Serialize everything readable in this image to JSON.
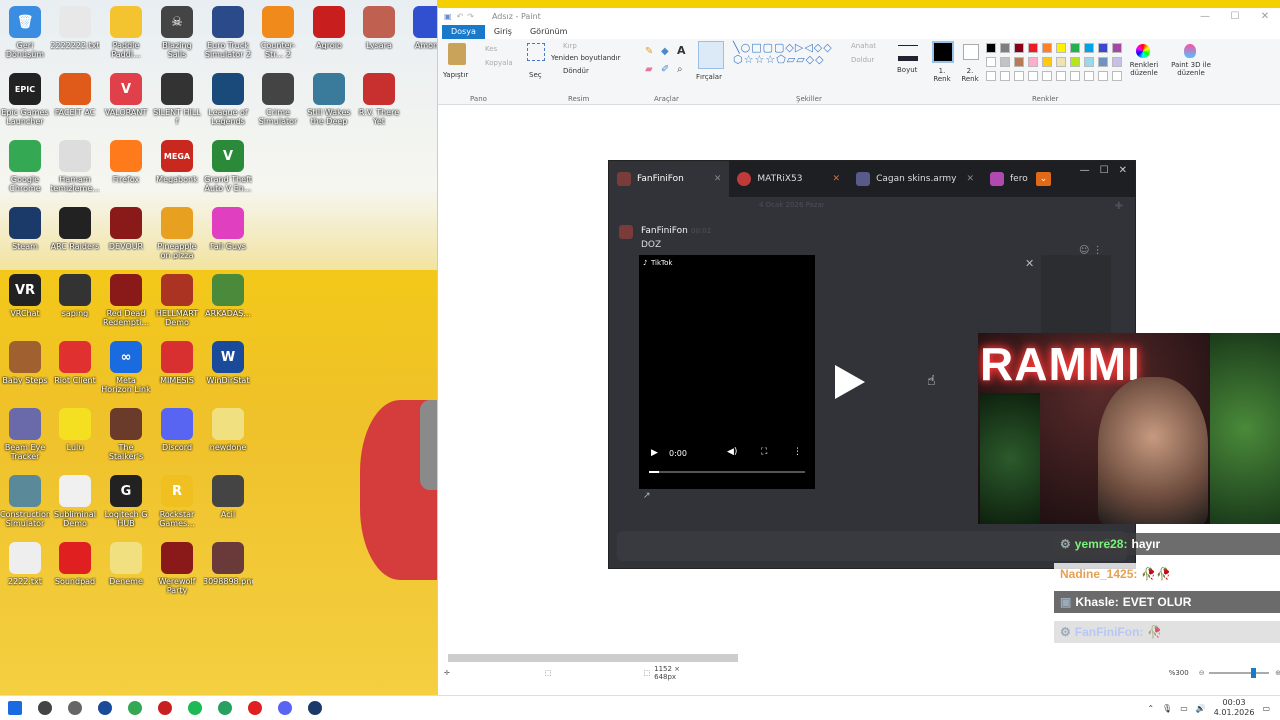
{
  "desktop": {
    "icons": [
      {
        "label": "Geri Dönüşüm",
        "color": "#3a8de0",
        "glyph": "🗑"
      },
      {
        "label": "2222222.txt",
        "color": "#e8e8e8",
        "glyph": ""
      },
      {
        "label": "Paddle Paddl...",
        "color": "#f4c430",
        "glyph": ""
      },
      {
        "label": "Blazing Sails",
        "color": "#444444",
        "glyph": "☠"
      },
      {
        "label": "Euro Truck Simulator 2",
        "color": "#2b4a8a",
        "glyph": ""
      },
      {
        "label": "Counter-Str... 2",
        "color": "#f08a1a",
        "glyph": ""
      },
      {
        "label": "Agroio",
        "color": "#c81e1e",
        "glyph": ""
      },
      {
        "label": "Lysara",
        "color": "#c06050",
        "glyph": ""
      },
      {
        "label": "Among",
        "color": "#3050d0",
        "glyph": ""
      },
      {
        "label": "Epic Games Launcher",
        "color": "#222222",
        "glyph": "EPIC"
      },
      {
        "label": "FACEIT AC",
        "color": "#e05a1a",
        "glyph": ""
      },
      {
        "label": "VALORANT",
        "color": "#e0404a",
        "glyph": "V"
      },
      {
        "label": "SILENT HILL f",
        "color": "#333333",
        "glyph": ""
      },
      {
        "label": "League of Legends",
        "color": "#1a4a7a",
        "glyph": ""
      },
      {
        "label": "Crime Simulator",
        "color": "#444444",
        "glyph": ""
      },
      {
        "label": "Still Wakes the Deep",
        "color": "#3a7a9a",
        "glyph": ""
      },
      {
        "label": "R.V. There Yet",
        "color": "#c83030",
        "glyph": ""
      },
      {
        "label": "Google Chrome",
        "color": "#34a853",
        "glyph": ""
      },
      {
        "label": "Hamam temizleme...",
        "color": "#dddddd",
        "glyph": ""
      },
      {
        "label": "Firefox",
        "color": "#ff7a1a",
        "glyph": ""
      },
      {
        "label": "Megabonk",
        "color": "#c8281e",
        "glyph": "MEGA"
      },
      {
        "label": "Grand Theft Auto V En...",
        "color": "#2a8a3a",
        "glyph": "V"
      },
      {
        "label": "Steam",
        "color": "#1b3a6a",
        "glyph": ""
      },
      {
        "label": "ARC Raiders",
        "color": "#222222",
        "glyph": ""
      },
      {
        "label": "DEVOUR",
        "color": "#8a1a1a",
        "glyph": ""
      },
      {
        "label": "Pineapple on pizza",
        "color": "#e8a020",
        "glyph": ""
      },
      {
        "label": "Fall Guys",
        "color": "#e040c0",
        "glyph": ""
      },
      {
        "label": "VRChat",
        "color": "#222222",
        "glyph": "VR"
      },
      {
        "label": "saping",
        "color": "#333333",
        "glyph": ""
      },
      {
        "label": "Red Dead Redempti...",
        "color": "#8a1a1a",
        "glyph": ""
      },
      {
        "label": "HELLMART Demo",
        "color": "#aa3322",
        "glyph": ""
      },
      {
        "label": "ARKADAŞ...",
        "color": "#4a8a3a",
        "glyph": ""
      },
      {
        "label": "Baby Steps",
        "color": "#a06030",
        "glyph": ""
      },
      {
        "label": "Riot Client",
        "color": "#e03030",
        "glyph": ""
      },
      {
        "label": "Meta Horizon Link",
        "color": "#1a6ae0",
        "glyph": "∞"
      },
      {
        "label": "MIMESIS",
        "color": "#d83030",
        "glyph": ""
      },
      {
        "label": "WinDirStat",
        "color": "#1a4a9a",
        "glyph": "W"
      },
      {
        "label": "Beam Eye Tracker",
        "color": "#6a6aaa",
        "glyph": ""
      },
      {
        "label": "Lulu",
        "color": "#f4e020",
        "glyph": ""
      },
      {
        "label": "The Stalker's Demo",
        "color": "#6a3a2a",
        "glyph": ""
      },
      {
        "label": "Discord",
        "color": "#5865f2",
        "glyph": ""
      },
      {
        "label": "newdone",
        "color": "#f0e080",
        "glyph": ""
      },
      {
        "label": "Construction Simulator",
        "color": "#5a8a9a",
        "glyph": ""
      },
      {
        "label": "Subliminal Demo",
        "color": "#f0f0f0",
        "glyph": ""
      },
      {
        "label": "Logitech G HUB",
        "color": "#222222",
        "glyph": "G"
      },
      {
        "label": "Rockstar Games...",
        "color": "#f0c020",
        "glyph": "R"
      },
      {
        "label": "Acil",
        "color": "#444444",
        "glyph": ""
      },
      {
        "label": "2222.txt",
        "color": "#eeeeee",
        "glyph": ""
      },
      {
        "label": "Soundpad",
        "color": "#e02020",
        "glyph": ""
      },
      {
        "label": "Deneme",
        "color": "#f0e080",
        "glyph": ""
      },
      {
        "label": "Werewolf Party",
        "color": "#8a1a1a",
        "glyph": ""
      },
      {
        "label": "3098898.png",
        "color": "#6a3a3a",
        "glyph": ""
      }
    ]
  },
  "paint": {
    "title": "Adsız - Paint",
    "menu": {
      "file": "Dosya",
      "home": "Giriş",
      "view": "Görünüm"
    },
    "ribbon": {
      "paste": "Yapıştır",
      "cut": "Kes",
      "copy": "Kopyala",
      "select": "Seç",
      "crop": "Kırp",
      "resize": "Yeniden boyutlandır",
      "rotate": "Döndür",
      "brushes": "Fırçalar",
      "outline": "Anahat",
      "fill": "Doldur",
      "size": "Boyut",
      "color1": "1. Renk",
      "color2": "2. Renk",
      "edit_colors": "Renkleri düzenle",
      "paint3d": "Paint 3D ile düzenle",
      "groups": {
        "clipboard": "Pano",
        "image": "Resim",
        "tools": "Araçlar",
        "shapes": "Şekiller",
        "colors": "Renkler"
      }
    },
    "palette": [
      "#000000",
      "#7f7f7f",
      "#880015",
      "#ed1c24",
      "#ff7f27",
      "#fff200",
      "#22b14c",
      "#00a2e8",
      "#3f48cc",
      "#a349a4",
      "#ffffff",
      "#c3c3c3",
      "#b97a57",
      "#ffaec9",
      "#ffc90e",
      "#efe4b0",
      "#b5e61d",
      "#99d9ea",
      "#7092be",
      "#c8bfe7"
    ],
    "status": {
      "size": "1152 × 648px",
      "zoom": "%300"
    }
  },
  "discord": {
    "tabs": [
      {
        "label": "FanFiniFon",
        "active": true
      },
      {
        "label": "MATRiX53",
        "active": false
      },
      {
        "label": "Cagan skins.army",
        "active": false
      },
      {
        "label": "fero",
        "active": false
      }
    ],
    "date_divider": "4 Ocak 2026 Pazar",
    "message": {
      "author": "FanFiniFon",
      "time": "00:02",
      "text": "DOZ"
    },
    "embed": {
      "provider": "TikTok",
      "time": "0:00"
    }
  },
  "webcam": {
    "sign": "RAMMI"
  },
  "chat": [
    {
      "user": "yemre28:",
      "text": "hayır",
      "color": "#7bf27b"
    },
    {
      "user": "Nadine_1425:",
      "text": "🥀🥀",
      "color": "#e8a050"
    },
    {
      "user": "Khasle:",
      "text": "EVET OLUR",
      "color": "#ffffff"
    },
    {
      "user": "FanFiniFon:",
      "text": "🥀",
      "color": "#9ab8ff"
    }
  ],
  "taskbar": {
    "apps": [
      {
        "name": "windows-start",
        "color": "#1a6ae0"
      },
      {
        "name": "search",
        "color": "#444444"
      },
      {
        "name": "task-view",
        "color": "#666666"
      },
      {
        "name": "windirstat",
        "color": "#1a4a9a"
      },
      {
        "name": "chrome",
        "color": "#34a853"
      },
      {
        "name": "voice-app",
        "color": "#c82020"
      },
      {
        "name": "spotify",
        "color": "#1db954"
      },
      {
        "name": "app-green",
        "color": "#2aa060"
      },
      {
        "name": "youtube",
        "color": "#e02020"
      },
      {
        "name": "discord",
        "color": "#5865f2"
      },
      {
        "name": "steam",
        "color": "#1b3a6a"
      }
    ],
    "time": "00:03",
    "date": "4.01.2026"
  }
}
